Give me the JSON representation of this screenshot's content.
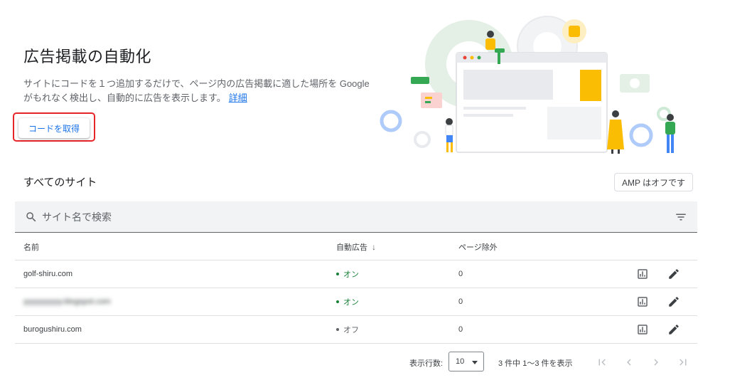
{
  "header": {
    "title": "広告掲載の自動化",
    "description": "サイトにコードを１つ追加するだけで、ページ内の広告掲載に適した場所を Google がもれなく検出し、自動的に広告を表示します。",
    "learn_more": "詳細",
    "get_code_button": "コードを取得"
  },
  "sites": {
    "title": "すべてのサイト",
    "amp_button": "AMP はオフです",
    "search_placeholder": "サイト名で検索",
    "columns": {
      "name": "名前",
      "auto_ads": "自動広告",
      "page_exclusions": "ページ除外"
    },
    "rows": [
      {
        "name": "golf-shiru.com",
        "status": "オン",
        "exclusions": "0"
      },
      {
        "name": "yyyyyyyyyy.blogspot.com",
        "status": "オン",
        "exclusions": "0"
      },
      {
        "name": "burogushiru.com",
        "status": "オフ",
        "exclusions": "0"
      }
    ]
  },
  "pagination": {
    "rows_per_page_label": "表示行数:",
    "rows_per_page_value": "10",
    "range_text": "3 件中 1〜3 件を表示"
  },
  "colors": {
    "accent": "#1a73e8",
    "status_on": "#188038",
    "status_off": "#5f6368",
    "highlight": "#e52528"
  }
}
